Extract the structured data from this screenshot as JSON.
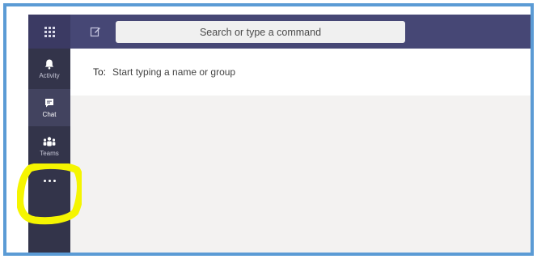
{
  "search": {
    "placeholder": "Search or type a command"
  },
  "rail": {
    "items": [
      {
        "label": "Activity",
        "icon": "bell-icon"
      },
      {
        "label": "Chat",
        "icon": "chat-icon",
        "active": true
      },
      {
        "label": "Teams",
        "icon": "teams-icon"
      },
      {
        "label": "",
        "icon": "more-icon"
      }
    ]
  },
  "compose": {
    "to_label": "To:",
    "to_placeholder": "Start typing a name or group"
  },
  "colors": {
    "topbar": "#464775",
    "rail": "#33344a",
    "content": "#f3f2f1",
    "frame_border": "#5b9bd5",
    "highlight": "#f5f500"
  }
}
